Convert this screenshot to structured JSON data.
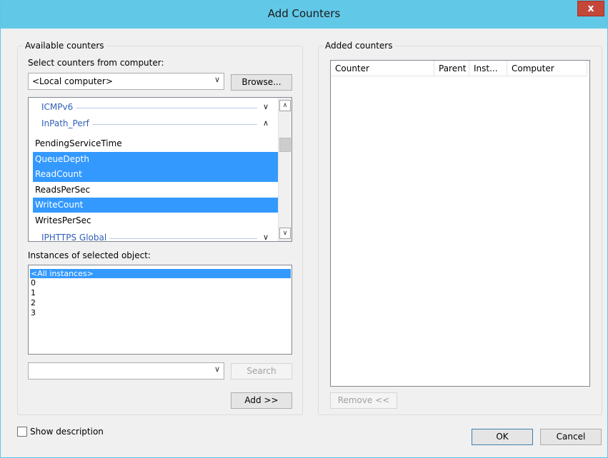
{
  "window": {
    "title": "Add Counters",
    "close_glyph": "x"
  },
  "available": {
    "legend": "Available counters",
    "select_computer_label": "Select counters from computer:",
    "computer_value": "<Local computer>",
    "browse_label": "Browse...",
    "objects": [
      {
        "name": "ICMPv6",
        "chevron": "∨"
      },
      {
        "name": "InPath_Perf",
        "chevron": "∧"
      },
      {
        "name": "IPHTTPS Global",
        "chevron": "∨"
      }
    ],
    "counters": [
      {
        "label": "PendingServiceTime",
        "selected": false
      },
      {
        "label": "QueueDepth",
        "selected": true
      },
      {
        "label": "ReadCount",
        "selected": true
      },
      {
        "label": "ReadsPerSec",
        "selected": false
      },
      {
        "label": "WriteCount",
        "selected": true
      },
      {
        "label": "WritesPerSec",
        "selected": false
      }
    ],
    "instances_label": "Instances of selected object:",
    "instances": [
      {
        "label": "<All instances>",
        "selected": true
      },
      {
        "label": "0",
        "selected": false
      },
      {
        "label": "1",
        "selected": false
      },
      {
        "label": "2",
        "selected": false
      },
      {
        "label": "3",
        "selected": false
      }
    ],
    "search_value": "",
    "search_label": "Search",
    "add_label": "Add >>"
  },
  "added": {
    "legend": "Added counters",
    "columns": [
      "Counter",
      "Parent",
      "Inst...",
      "Computer"
    ],
    "remove_label": "Remove <<"
  },
  "footer": {
    "show_description_label": "Show description",
    "show_description_checked": false,
    "ok_label": "OK",
    "cancel_label": "Cancel"
  },
  "colors": {
    "titlebar": "#62c8e8",
    "selection": "#3399ff",
    "object_text": "#3060b8",
    "close": "#c4473a"
  }
}
